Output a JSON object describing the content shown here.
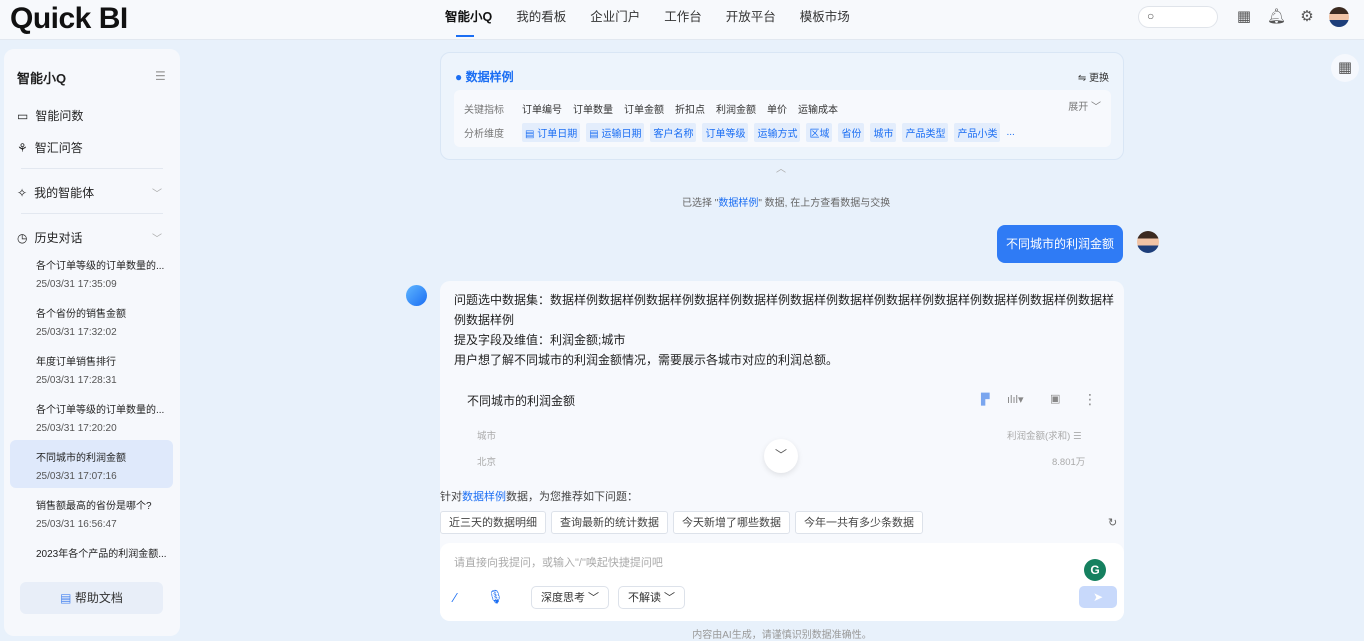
{
  "header": {
    "logo": "Quick BI",
    "nav": [
      "智能小Q",
      "我的看板",
      "企业门户",
      "工作台",
      "开放平台",
      "模板市场"
    ]
  },
  "sidebar": {
    "title": "智能小Q",
    "items": [
      {
        "label": "智能问数",
        "icon": "chart-chat-icon"
      },
      {
        "label": "智汇问答",
        "icon": "bubbles-icon"
      }
    ],
    "agents": "我的智能体",
    "history": "历史对话",
    "history_items": [
      {
        "title": "各个订单等级的订单数量的...",
        "date": "25/03/31 17:35:09"
      },
      {
        "title": "各个省份的销售金额",
        "date": "25/03/31 17:32:02"
      },
      {
        "title": "年度订单销售排行",
        "date": "25/03/31 17:28:31"
      },
      {
        "title": "各个订单等级的订单数量的...",
        "date": "25/03/31 17:20:20"
      },
      {
        "title": "不同城市的利润金额",
        "date": "25/03/31 17:07:16"
      },
      {
        "title": "销售额最高的省份是哪个?",
        "date": "25/03/31 16:56:47"
      },
      {
        "title": "2023年各个产品的利润金额...",
        "date": ""
      }
    ],
    "help": "帮助文档"
  },
  "dataset": {
    "name": "数据样例",
    "switch": "⇋ 更换",
    "metrics_label": "关键指标",
    "metrics": [
      "订单编号",
      "订单数量",
      "订单金额",
      "折扣点",
      "利润金额",
      "单价",
      "运输成本"
    ],
    "dims_label": "分析维度",
    "dims": [
      "订单日期",
      "运输日期",
      "客户名称",
      "订单等级",
      "运输方式",
      "区域",
      "省份",
      "城市",
      "产品类型",
      "产品小类"
    ],
    "more": "...",
    "expand": "展开"
  },
  "note": {
    "pre": "已选择 \"",
    "name": "数据样例",
    "post": "\" 数据, 在上方查看数据与交换"
  },
  "user_msg": "不同城市的利润金额",
  "answer": {
    "l1": "问题选中数据集：数据样例数据样例数据样例数据样例数据样例数据样例数据样例数据样例数据样例数据样例数据样例数据样例数据样例",
    "l2": "提及字段及维值：利润金额;城市",
    "l3": "用户想了解不同城市的利润金额情况，需要展示各城市对应的利润总额。",
    "card_title": "不同城市的利润金额",
    "col1": "城市",
    "col2": "利润金额(求和)",
    "row_city": "北京",
    "row_val": "8.801万"
  },
  "recommend": {
    "pre": "针对",
    "name": "数据样例",
    "post": "数据，为您推荐如下问题：",
    "chips": [
      "近三天的数据明细",
      "查询最新的统计数据",
      "今天新增了哪些数据",
      "今年一共有多少条数据"
    ]
  },
  "input": {
    "placeholder": "请直接向我提问，或输入\"/\"唤起快捷提问吧",
    "think": "深度思考",
    "interpret": "不解读"
  },
  "footer": "内容由AI生成，请谨慎识别数据准确性。"
}
